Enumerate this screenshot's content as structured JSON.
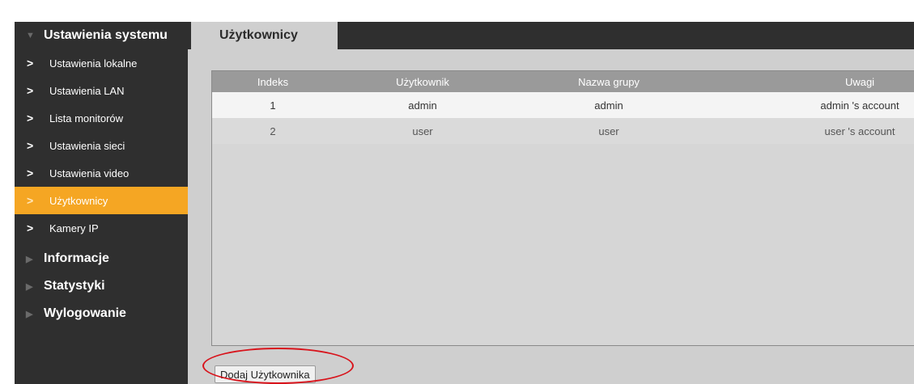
{
  "sidebar": {
    "section_title": "Ustawienia systemu",
    "items": [
      {
        "label": "Ustawienia lokalne"
      },
      {
        "label": "Ustawienia LAN"
      },
      {
        "label": "Lista monitorów"
      },
      {
        "label": "Ustawienia sieci"
      },
      {
        "label": "Ustawienia video"
      },
      {
        "label": "Użytkownicy",
        "active": true
      },
      {
        "label": "Kamery IP"
      }
    ],
    "sections": [
      {
        "label": "Informacje"
      },
      {
        "label": "Statystyki"
      },
      {
        "label": "Wylogowanie"
      }
    ],
    "icons": {
      "expanded": "triangle-down-icon",
      "collapsed": "triangle-right-icon",
      "item": "chevron-right-icon"
    }
  },
  "main": {
    "tab_label": "Użytkownicy",
    "table": {
      "columns": [
        "Indeks",
        "Użytkownik",
        "Nazwa grupy",
        "Uwagi"
      ],
      "rows": [
        [
          "1",
          "admin",
          "admin",
          "admin 's account"
        ],
        [
          "2",
          "user",
          "user",
          "user 's account"
        ]
      ]
    },
    "add_button_label": "Dodaj Użytkownika"
  },
  "colors": {
    "accent": "#f5a623",
    "sidebar_bg": "#2f2f2f",
    "highlight": "#d8141c"
  }
}
